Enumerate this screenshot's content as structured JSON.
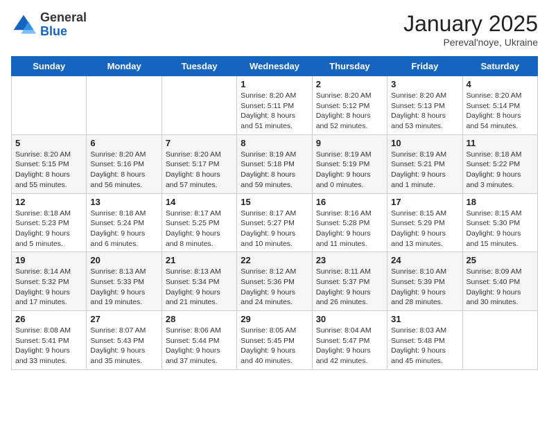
{
  "logo": {
    "general": "General",
    "blue": "Blue"
  },
  "title": "January 2025",
  "subtitle": "Pereval'noye, Ukraine",
  "days_of_week": [
    "Sunday",
    "Monday",
    "Tuesday",
    "Wednesday",
    "Thursday",
    "Friday",
    "Saturday"
  ],
  "weeks": [
    [
      {
        "day": "",
        "info": ""
      },
      {
        "day": "",
        "info": ""
      },
      {
        "day": "",
        "info": ""
      },
      {
        "day": "1",
        "info": "Sunrise: 8:20 AM\nSunset: 5:11 PM\nDaylight: 8 hours and 51 minutes."
      },
      {
        "day": "2",
        "info": "Sunrise: 8:20 AM\nSunset: 5:12 PM\nDaylight: 8 hours and 52 minutes."
      },
      {
        "day": "3",
        "info": "Sunrise: 8:20 AM\nSunset: 5:13 PM\nDaylight: 8 hours and 53 minutes."
      },
      {
        "day": "4",
        "info": "Sunrise: 8:20 AM\nSunset: 5:14 PM\nDaylight: 8 hours and 54 minutes."
      }
    ],
    [
      {
        "day": "5",
        "info": "Sunrise: 8:20 AM\nSunset: 5:15 PM\nDaylight: 8 hours and 55 minutes."
      },
      {
        "day": "6",
        "info": "Sunrise: 8:20 AM\nSunset: 5:16 PM\nDaylight: 8 hours and 56 minutes."
      },
      {
        "day": "7",
        "info": "Sunrise: 8:20 AM\nSunset: 5:17 PM\nDaylight: 8 hours and 57 minutes."
      },
      {
        "day": "8",
        "info": "Sunrise: 8:19 AM\nSunset: 5:18 PM\nDaylight: 8 hours and 59 minutes."
      },
      {
        "day": "9",
        "info": "Sunrise: 8:19 AM\nSunset: 5:19 PM\nDaylight: 9 hours and 0 minutes."
      },
      {
        "day": "10",
        "info": "Sunrise: 8:19 AM\nSunset: 5:21 PM\nDaylight: 9 hours and 1 minute."
      },
      {
        "day": "11",
        "info": "Sunrise: 8:18 AM\nSunset: 5:22 PM\nDaylight: 9 hours and 3 minutes."
      }
    ],
    [
      {
        "day": "12",
        "info": "Sunrise: 8:18 AM\nSunset: 5:23 PM\nDaylight: 9 hours and 5 minutes."
      },
      {
        "day": "13",
        "info": "Sunrise: 8:18 AM\nSunset: 5:24 PM\nDaylight: 9 hours and 6 minutes."
      },
      {
        "day": "14",
        "info": "Sunrise: 8:17 AM\nSunset: 5:25 PM\nDaylight: 9 hours and 8 minutes."
      },
      {
        "day": "15",
        "info": "Sunrise: 8:17 AM\nSunset: 5:27 PM\nDaylight: 9 hours and 10 minutes."
      },
      {
        "day": "16",
        "info": "Sunrise: 8:16 AM\nSunset: 5:28 PM\nDaylight: 9 hours and 11 minutes."
      },
      {
        "day": "17",
        "info": "Sunrise: 8:15 AM\nSunset: 5:29 PM\nDaylight: 9 hours and 13 minutes."
      },
      {
        "day": "18",
        "info": "Sunrise: 8:15 AM\nSunset: 5:30 PM\nDaylight: 9 hours and 15 minutes."
      }
    ],
    [
      {
        "day": "19",
        "info": "Sunrise: 8:14 AM\nSunset: 5:32 PM\nDaylight: 9 hours and 17 minutes."
      },
      {
        "day": "20",
        "info": "Sunrise: 8:13 AM\nSunset: 5:33 PM\nDaylight: 9 hours and 19 minutes."
      },
      {
        "day": "21",
        "info": "Sunrise: 8:13 AM\nSunset: 5:34 PM\nDaylight: 9 hours and 21 minutes."
      },
      {
        "day": "22",
        "info": "Sunrise: 8:12 AM\nSunset: 5:36 PM\nDaylight: 9 hours and 24 minutes."
      },
      {
        "day": "23",
        "info": "Sunrise: 8:11 AM\nSunset: 5:37 PM\nDaylight: 9 hours and 26 minutes."
      },
      {
        "day": "24",
        "info": "Sunrise: 8:10 AM\nSunset: 5:39 PM\nDaylight: 9 hours and 28 minutes."
      },
      {
        "day": "25",
        "info": "Sunrise: 8:09 AM\nSunset: 5:40 PM\nDaylight: 9 hours and 30 minutes."
      }
    ],
    [
      {
        "day": "26",
        "info": "Sunrise: 8:08 AM\nSunset: 5:41 PM\nDaylight: 9 hours and 33 minutes."
      },
      {
        "day": "27",
        "info": "Sunrise: 8:07 AM\nSunset: 5:43 PM\nDaylight: 9 hours and 35 minutes."
      },
      {
        "day": "28",
        "info": "Sunrise: 8:06 AM\nSunset: 5:44 PM\nDaylight: 9 hours and 37 minutes."
      },
      {
        "day": "29",
        "info": "Sunrise: 8:05 AM\nSunset: 5:45 PM\nDaylight: 9 hours and 40 minutes."
      },
      {
        "day": "30",
        "info": "Sunrise: 8:04 AM\nSunset: 5:47 PM\nDaylight: 9 hours and 42 minutes."
      },
      {
        "day": "31",
        "info": "Sunrise: 8:03 AM\nSunset: 5:48 PM\nDaylight: 9 hours and 45 minutes."
      },
      {
        "day": "",
        "info": ""
      }
    ]
  ]
}
